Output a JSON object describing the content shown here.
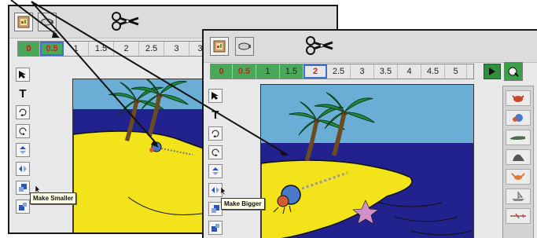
{
  "window_back": {
    "timeline": [
      "0",
      "0.5",
      "1",
      "1.5",
      "2",
      "2.5",
      "3",
      "3"
    ],
    "selected_index": 1,
    "tooltip": "Make Smaller"
  },
  "window_front": {
    "timeline": [
      "0",
      "0.5",
      "1",
      "1.5",
      "2",
      "2.5",
      "3",
      "3.5",
      "4",
      "4.5",
      "5"
    ],
    "selected_index": 4,
    "tooltip": "Make Bigger",
    "stamps": [
      "crab",
      "hermit-crab",
      "alligator",
      "seal",
      "lobster",
      "ship",
      "plane"
    ]
  },
  "tools": [
    "arrow",
    "text",
    "rotate-cw",
    "rotate-ccw",
    "flip-vertical",
    "flip-horizontal",
    "make-smaller",
    "make-bigger"
  ],
  "colors": {
    "sky": "#6aaed6",
    "sea": "#22228e",
    "sand": "#f2e31a",
    "palm": "#1f8a3c",
    "trunk": "#6a4b22",
    "time_red": "#d21e1e",
    "play_green": "#2f8f3c"
  },
  "icons": {
    "toolbar": [
      "picture-frame-icon",
      "paint-tube-icon",
      "scissors-icon"
    ]
  }
}
